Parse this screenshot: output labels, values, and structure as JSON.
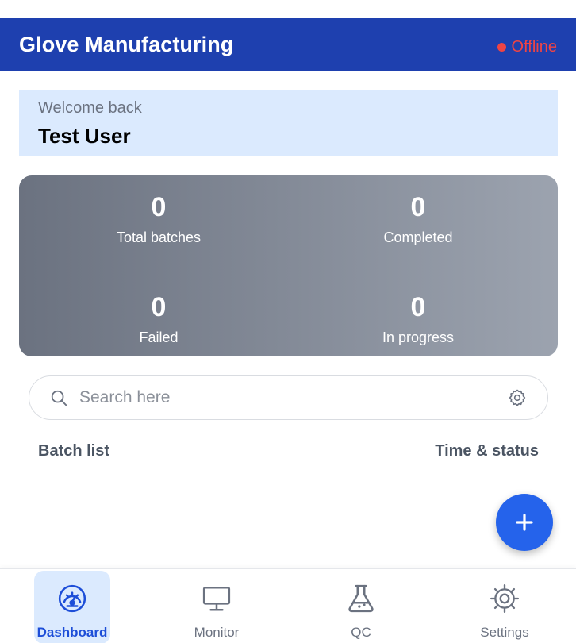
{
  "header": {
    "title": "Glove Manufacturing",
    "status": "Offline"
  },
  "welcome": {
    "label": "Welcome back",
    "name": "Test User"
  },
  "stats": [
    {
      "value": "0",
      "label": "Total batches"
    },
    {
      "value": "0",
      "label": "Completed"
    },
    {
      "value": "0",
      "label": "Failed"
    },
    {
      "value": "0",
      "label": "In progress"
    }
  ],
  "search": {
    "placeholder": "Search here",
    "value": ""
  },
  "list": {
    "title": "Batch list",
    "meta": "Time & status"
  },
  "nav": [
    {
      "label": "Dashboard",
      "icon": "dashboard-gauge-icon",
      "active": true
    },
    {
      "label": "Monitor",
      "icon": "monitor-icon",
      "active": false
    },
    {
      "label": "QC",
      "icon": "flask-icon",
      "active": false
    },
    {
      "label": "Settings",
      "icon": "gear-icon",
      "active": false
    }
  ],
  "colors": {
    "header": "#1e40af",
    "offline": "#ef4444",
    "welcome_bg": "#dbeafe",
    "accent": "#2563eb",
    "stats_gradient_start": "#6b7280",
    "stats_gradient_end": "#9ca3af"
  }
}
